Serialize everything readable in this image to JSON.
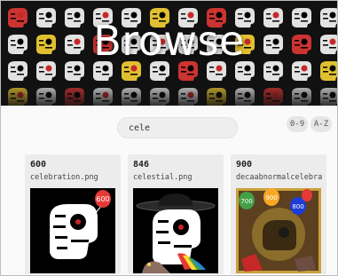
{
  "banner": {
    "title": "Browse"
  },
  "search": {
    "value": "cele"
  },
  "sort_buttons": {
    "numeric_label": "0-9",
    "alpha_label": "A-Z"
  },
  "cards": [
    {
      "number": "600",
      "filename": "celebration.png",
      "image": "skull-with-600-balloon"
    },
    {
      "number": "846",
      "filename": "celestial.png",
      "image": "skull-with-hat-and-rainbow"
    },
    {
      "number": "900",
      "filename": "decaabnormalcelebration",
      "image": "skull-with-700-800-900-balloons"
    }
  ]
}
